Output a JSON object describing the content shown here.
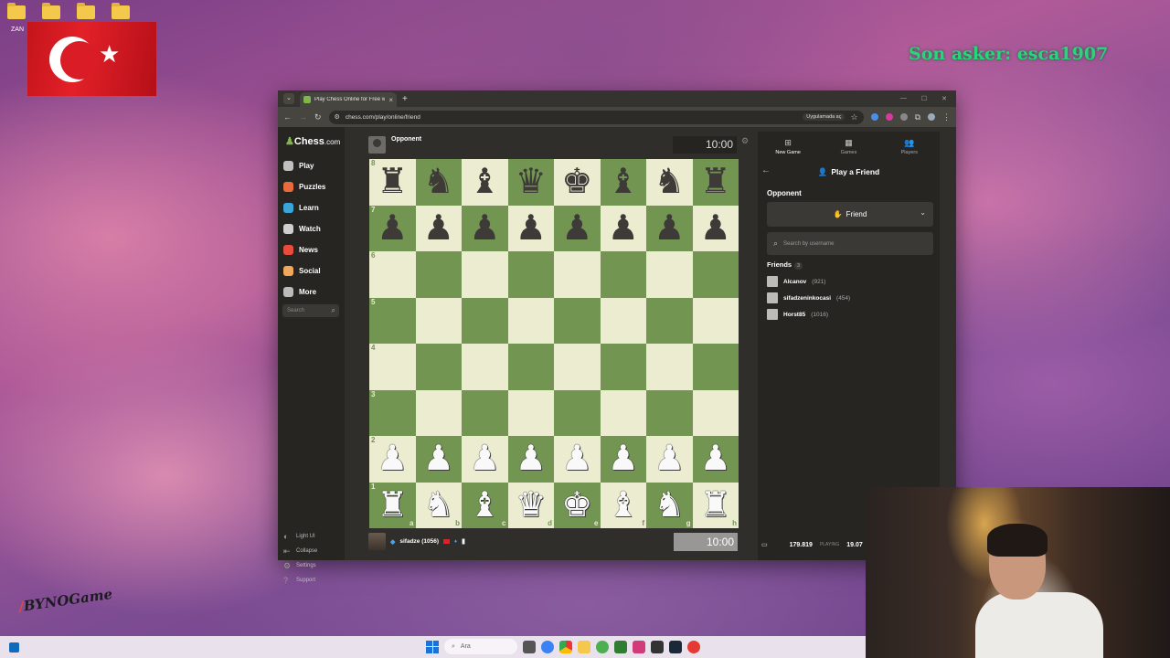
{
  "desktop": {
    "folder_label": "ZAN",
    "overlay_text": "Son asker: esca1907",
    "brand_logo_main": "BYNOGame",
    "brand_logo_prefix": "/"
  },
  "browser": {
    "tab_title": "Play Chess Online for Free with",
    "url": "chess.com/play/online/friend",
    "app_button": "Uygulamada aç"
  },
  "sidebar": {
    "logo": "Chess",
    "logo_domain": ".com",
    "items": [
      {
        "label": "Play",
        "icon": "play-icon",
        "color": "#c0c0c0"
      },
      {
        "label": "Puzzles",
        "icon": "puzzle-icon",
        "color": "#e96a3b"
      },
      {
        "label": "Learn",
        "icon": "learn-icon",
        "color": "#3aa6d8"
      },
      {
        "label": "Watch",
        "icon": "watch-icon",
        "color": "#cfcfcf"
      },
      {
        "label": "News",
        "icon": "news-icon",
        "color": "#e84c3d"
      },
      {
        "label": "Social",
        "icon": "social-icon",
        "color": "#f0a85b"
      },
      {
        "label": "More",
        "icon": "more-icon",
        "color": "#bbbbbb"
      }
    ],
    "search_placeholder": "Search",
    "bottom": [
      {
        "label": "Light UI",
        "icon": "contrast-icon"
      },
      {
        "label": "Collapse",
        "icon": "collapse-icon"
      },
      {
        "label": "Settings",
        "icon": "gear-icon"
      },
      {
        "label": "Support",
        "icon": "help-icon"
      }
    ]
  },
  "game": {
    "opponent_name": "Opponent",
    "opponent_clock": "10:00",
    "player_name": "sifadze (1056)",
    "player_clock": "10:00",
    "ranks": [
      "8",
      "7",
      "6",
      "5",
      "4",
      "3",
      "2",
      "1"
    ],
    "files": [
      "a",
      "b",
      "c",
      "d",
      "e",
      "f",
      "g",
      "h"
    ],
    "board": [
      [
        "bR",
        "bN",
        "bB",
        "bQ",
        "bK",
        "bB",
        "bN",
        "bR"
      ],
      [
        "bP",
        "bP",
        "bP",
        "bP",
        "bP",
        "bP",
        "bP",
        "bP"
      ],
      [
        "",
        "",
        "",
        "",
        "",
        "",
        "",
        ""
      ],
      [
        "",
        "",
        "",
        "",
        "",
        "",
        "",
        ""
      ],
      [
        "",
        "",
        "",
        "",
        "",
        "",
        "",
        ""
      ],
      [
        "",
        "",
        "",
        "",
        "",
        "",
        "",
        ""
      ],
      [
        "wP",
        "wP",
        "wP",
        "wP",
        "wP",
        "wP",
        "wP",
        "wP"
      ],
      [
        "wR",
        "wN",
        "wB",
        "wQ",
        "wK",
        "wB",
        "wN",
        "wR"
      ]
    ]
  },
  "panel": {
    "tabs": [
      {
        "label": "New Game",
        "icon": "plus-icon"
      },
      {
        "label": "Games",
        "icon": "grid-icon"
      },
      {
        "label": "Players",
        "icon": "players-icon"
      }
    ],
    "title": "Play a Friend",
    "opponent_label": "Opponent",
    "opponent_select": "Friend",
    "search_placeholder": "Search by username",
    "friends_title": "Friends",
    "friends_count": "3",
    "friends": [
      {
        "name": "Alcanov",
        "rating": "(921)"
      },
      {
        "name": "sifadzeninkocasi",
        "rating": "(454)"
      },
      {
        "name": "Horst85",
        "rating": "(1016)"
      }
    ],
    "playing_count": "179.819",
    "playing_label": "PLAYING",
    "games_count": "19.07"
  },
  "taskbar": {
    "search_placeholder": "Ara"
  }
}
